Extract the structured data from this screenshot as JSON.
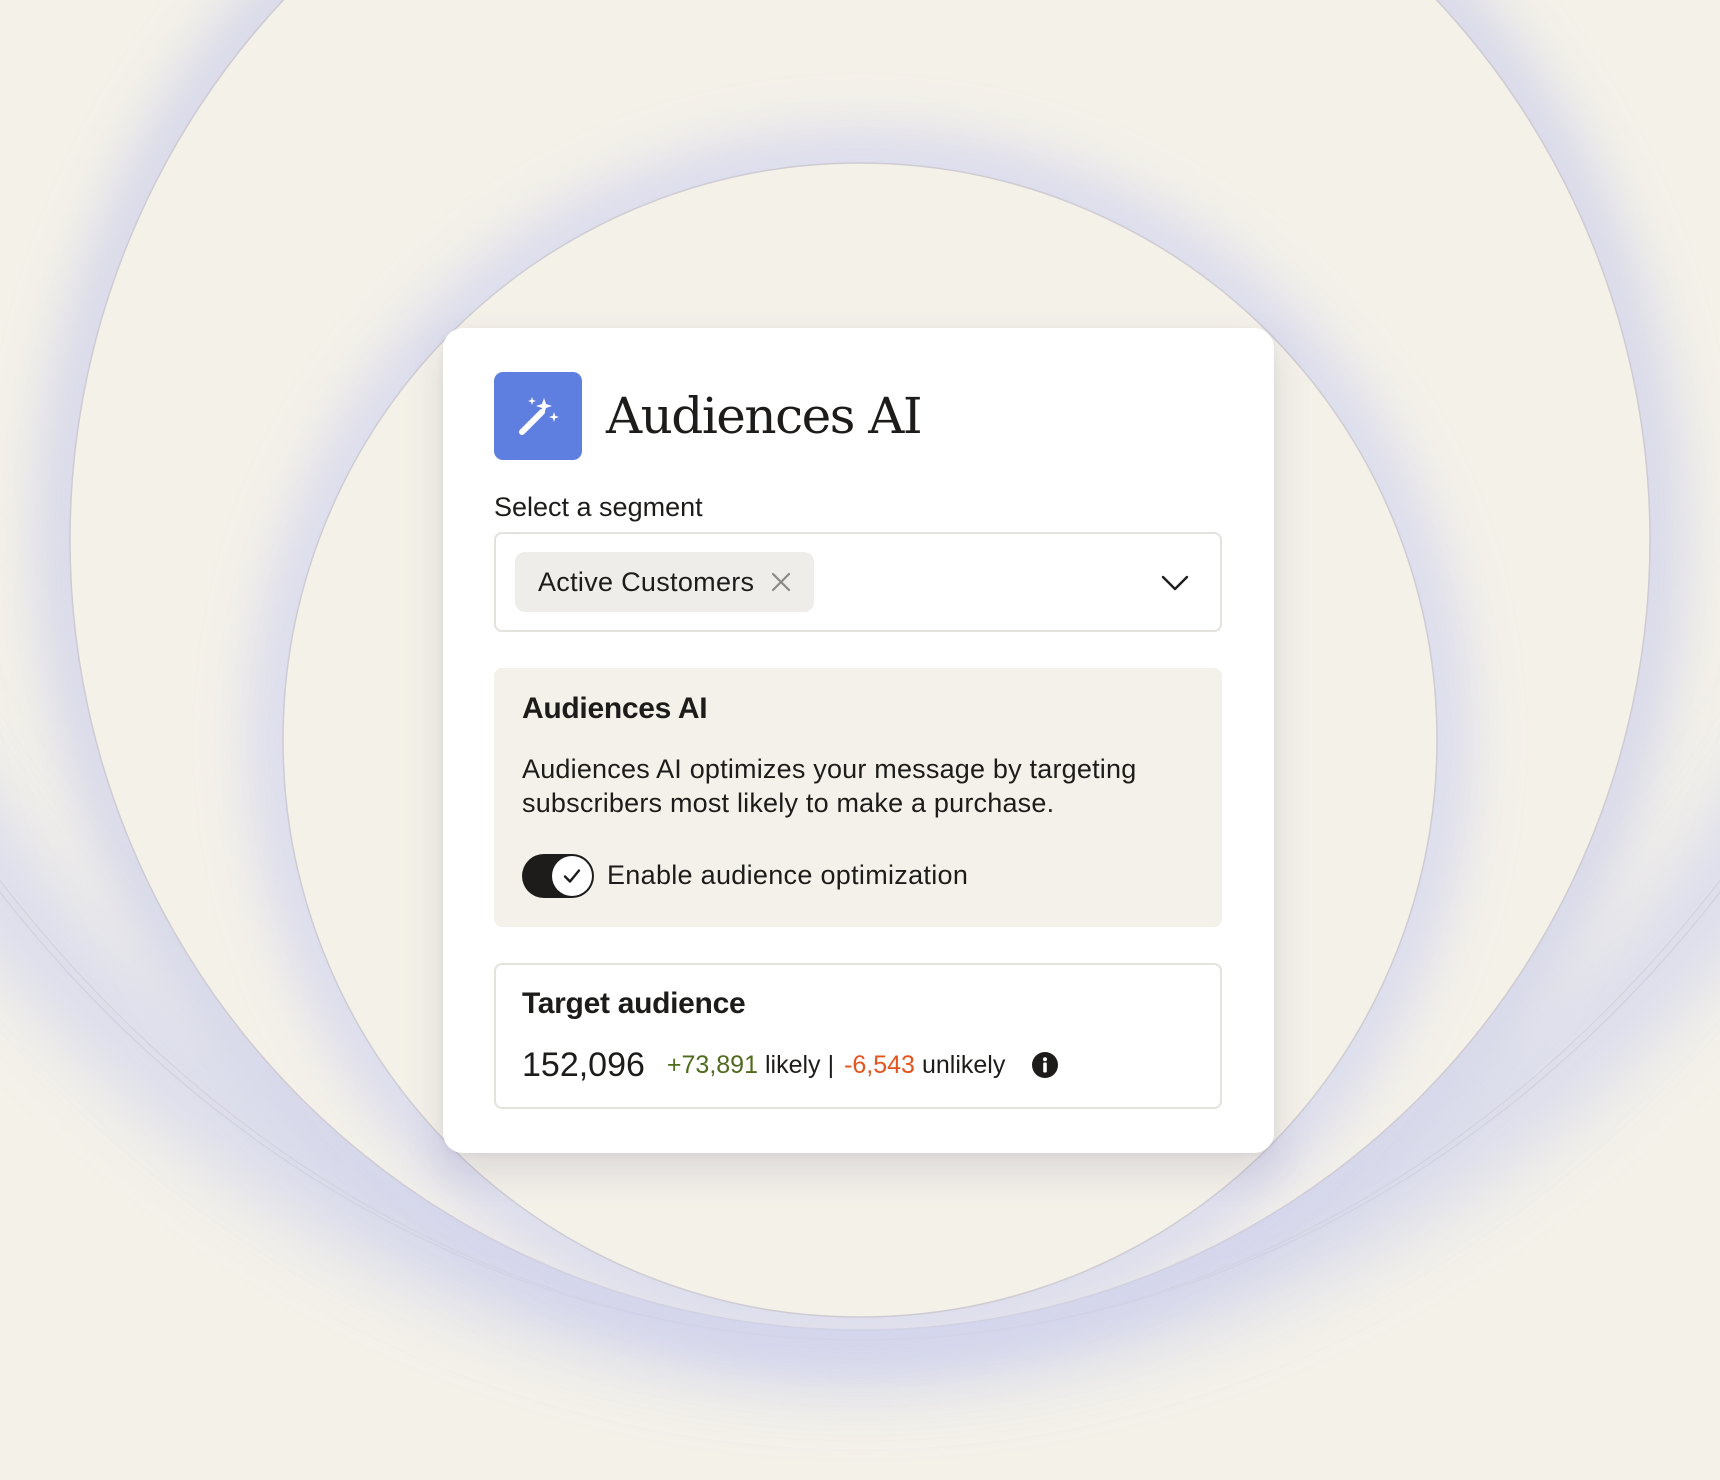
{
  "app": {
    "title": "Audiences AI",
    "icon": "magic-wand-icon",
    "accent_color": "#5f7fe0"
  },
  "segment": {
    "label": "Select a segment",
    "selected_chip": "Active Customers",
    "remove_icon": "close-icon",
    "dropdown_icon": "chevron-down-icon"
  },
  "ai_panel": {
    "title": "Audiences AI",
    "description": "Audiences AI optimizes your message by targeting subscribers most likely to make a purchase.",
    "toggle": {
      "label": "Enable audience optimization",
      "enabled": true,
      "icon": "checkmark-icon"
    }
  },
  "target": {
    "title": "Target audience",
    "total": "152,096",
    "likely_value": "+73,891",
    "likely_label": "likely",
    "separator": "|",
    "unlikely_value": "-6,543",
    "unlikely_label": "unlikely",
    "info_icon": "info-icon",
    "likely_color": "#4f6b1e",
    "unlikely_color": "#e4541e"
  }
}
